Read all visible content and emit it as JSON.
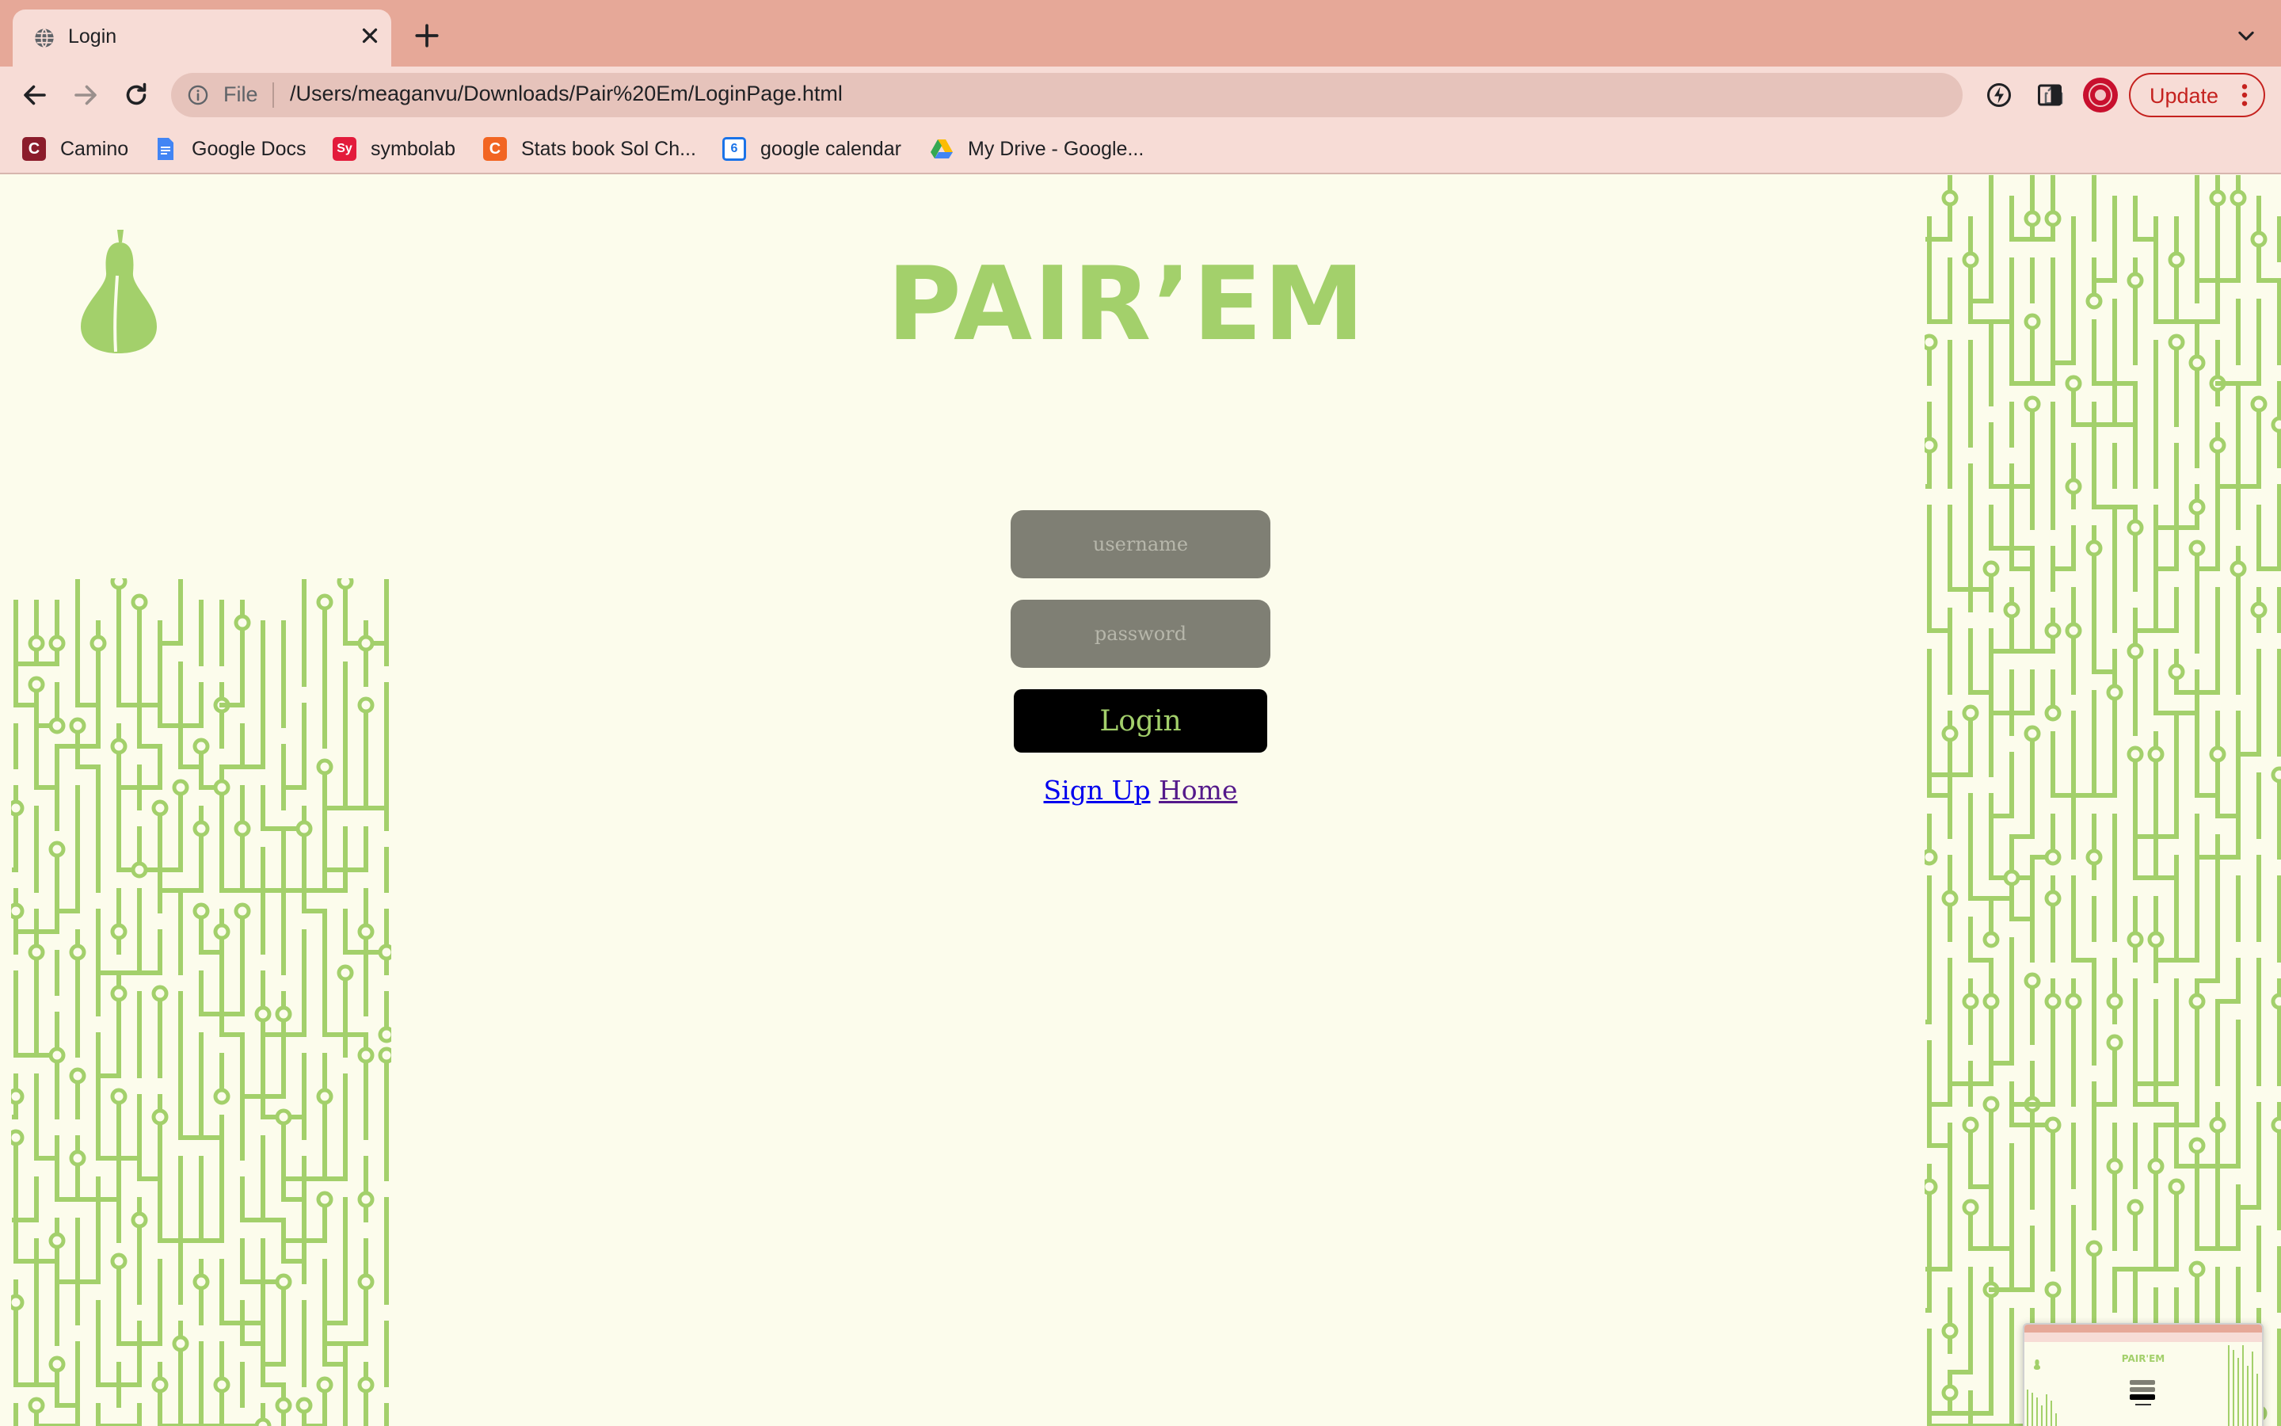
{
  "browser": {
    "tab": {
      "title": "Login"
    },
    "address_bar": {
      "scheme_label": "File",
      "url": "/Users/meaganvu/Downloads/Pair%20Em/LoginPage.html"
    },
    "update_button": {
      "label": "Update"
    },
    "bookmarks": [
      {
        "label": "Camino",
        "icon_glyph": "C",
        "color": "#8b1c2b"
      },
      {
        "label": "Google Docs",
        "icon_glyph": "",
        "color": "#4285f4"
      },
      {
        "label": "symbolab",
        "icon_glyph": "Sy",
        "color": "#e31b3b"
      },
      {
        "label": "Stats book Sol Ch...",
        "icon_glyph": "C",
        "color": "#f26522"
      },
      {
        "label": "google calendar",
        "icon_glyph": "6",
        "color": "#1a73e8"
      },
      {
        "label": "My Drive - Google...",
        "icon_glyph": "",
        "color": "#34a853"
      }
    ]
  },
  "page": {
    "brand": "PAIR’EM",
    "username_placeholder": "username",
    "password_placeholder": "password",
    "login_label": "Login",
    "signup_link": "Sign Up",
    "home_link": "Home",
    "preview_brand": "PAIR'EM"
  },
  "colors": {
    "page_background": "#fcfcec",
    "accent_green": "#a3d06b",
    "tab_strip": "#e6a898",
    "toolbar": "#f7dcd6"
  }
}
